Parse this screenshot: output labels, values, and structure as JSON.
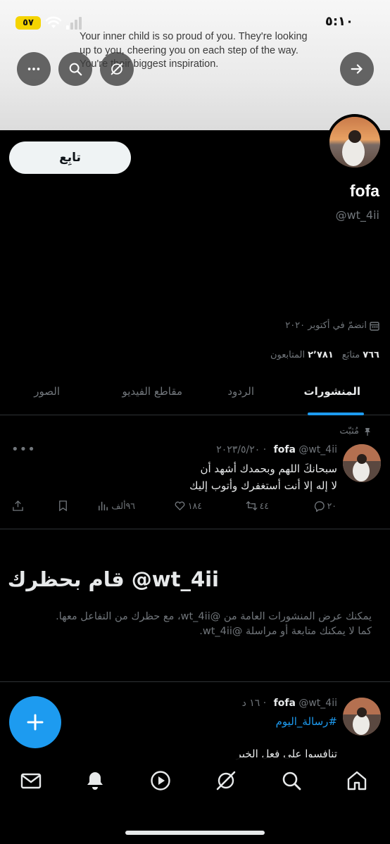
{
  "status_bar": {
    "time": "٥:١٠",
    "battery": "٥٧"
  },
  "banner": {
    "quote": "Your inner child is so proud of you. They're looking up to you, cheering you on each step of the way. You're their biggest inspiration."
  },
  "profile": {
    "follow_label": "تابِع",
    "display_name": "fofa",
    "handle": "@wt_4ii",
    "joined": "انضمّ في أكتوبر ٢٠٢٠",
    "following_count": "٧٦٦",
    "following_label": "متابَع",
    "followers_count": "٢٬٧٨١",
    "followers_label": "المتابعون"
  },
  "tabs": [
    {
      "label": "المنشورات",
      "active": true
    },
    {
      "label": "الردود",
      "active": false
    },
    {
      "label": "مقاطع الفيديو",
      "active": false
    },
    {
      "label": "الصور",
      "active": false
    }
  ],
  "pinned_label": "مُثبّت",
  "posts": [
    {
      "name": "fofa",
      "handle": "@wt_4ii",
      "date": "٢٠٢٣/٥/٢٠",
      "text_line1": "سبحانكَ اللهم وبحمدك أشهد أن",
      "text_line2": "لا إله إلا أنت أستغفرك وأتوب إليك",
      "replies": "٢٠",
      "reposts": "٤٤",
      "likes": "١٨٤",
      "views": "٩٦ألف"
    },
    {
      "name": "fofa",
      "handle": "@wt_4ii",
      "date": "١٦ د",
      "hashtag": "#رسالة_اليوم",
      "text_line1": "تنافسوا على فعل الخير"
    }
  ],
  "blocked": {
    "title": "قام بحظرك @wt_4ii",
    "body_line1": "يمكنك عرض المنشورات العامة من @wt_4ii، مع حظرك من التفاعل معها.",
    "body_line2": "كما لا يمكنك متابعة أو مراسلة @wt_4ii."
  },
  "icons": {
    "back": "arrow-right-icon",
    "more": "more-icon",
    "search": "search-icon",
    "grok": "grok-icon",
    "compose": "plus-icon"
  },
  "colors": {
    "accent": "#1d9bf0",
    "background": "#000000",
    "muted": "#71767b"
  }
}
